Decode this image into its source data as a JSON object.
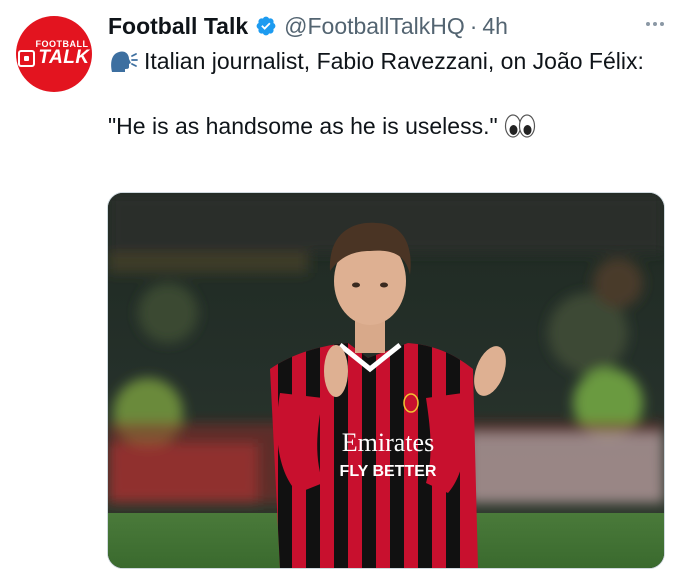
{
  "tweet": {
    "author_name": "Football Talk",
    "handle": "@FootballTalkHQ",
    "separator": "·",
    "time": "4h",
    "avatar": {
      "top_text": "FOOTBALL",
      "main_text": "TALK",
      "color": "#e3141f"
    },
    "verified_color": "#1d9bf0",
    "icons": {
      "speaking": "speaking-head-icon",
      "eyes": "eyes-icon",
      "more": "more-options-icon",
      "verified": "verified-badge-icon"
    },
    "text_line1": "Italian journalist, Fabio Ravezzani, on João Félix:",
    "text_line2": "\"He is as handsome as he is useless.\"",
    "media": {
      "shirt_sponsor_line1": "Emirates",
      "shirt_sponsor_line2": "FLY BETTER"
    }
  }
}
